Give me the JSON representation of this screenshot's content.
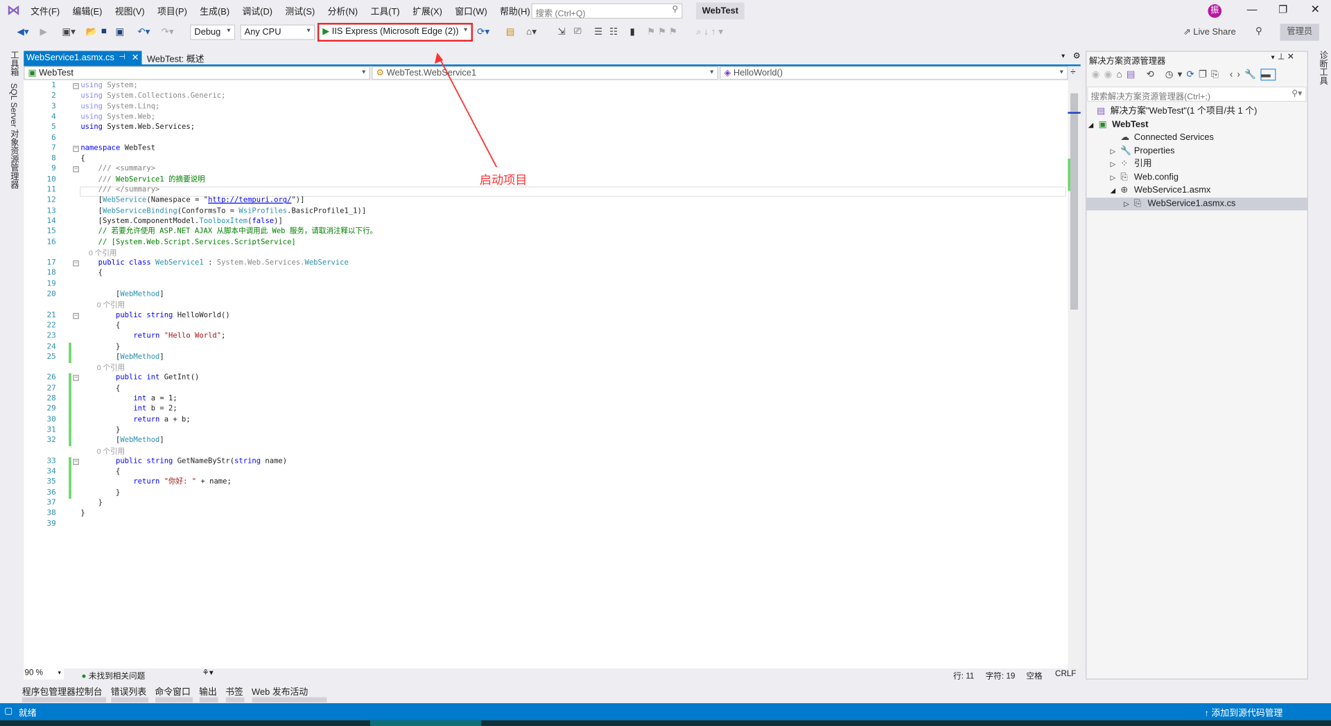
{
  "menu": [
    "文件(F)",
    "编辑(E)",
    "视图(V)",
    "项目(P)",
    "生成(B)",
    "调试(D)",
    "测试(S)",
    "分析(N)",
    "工具(T)",
    "扩展(X)",
    "窗口(W)",
    "帮助(H)"
  ],
  "search_placeholder": "搜索 (Ctrl+Q)",
  "solution_badge": "WebTest",
  "avatar_letter": "振",
  "toolbar": {
    "config": "Debug",
    "platform": "Any CPU",
    "start": "IIS Express (Microsoft Edge (2))",
    "live_share": "Live Share",
    "admin": "管理员"
  },
  "left_strip": [
    "工具箱",
    "SQL Server 对象资源管理器"
  ],
  "right_strip": "诊断工具",
  "tabs": [
    {
      "label": "WebService1.asmx.cs",
      "active": true
    },
    {
      "label": "WebTest: 概述",
      "active": false
    }
  ],
  "nav": {
    "project": "WebTest",
    "class": "WebTest.WebService1",
    "member": "HelloWorld()"
  },
  "annotation": {
    "label": "启动项目",
    "color": "#ff3333"
  },
  "code": [
    {
      "n": "1",
      "t": [
        [
          "fd",
          "using"
        ],
        [
          "fg",
          " System;"
        ]
      ]
    },
    {
      "n": "2",
      "t": [
        [
          "fd",
          "using"
        ],
        [
          "fg",
          " System.Collections.Generic;"
        ]
      ]
    },
    {
      "n": "3",
      "t": [
        [
          "fd",
          "using"
        ],
        [
          "fg",
          " System.Linq;"
        ]
      ]
    },
    {
      "n": "4",
      "t": [
        [
          "fd",
          "using"
        ],
        [
          "fg",
          " System.Web;"
        ]
      ]
    },
    {
      "n": "5",
      "t": [
        [
          "kw",
          "using"
        ],
        [
          "tx",
          " System.Web.Services;"
        ]
      ]
    },
    {
      "n": "6",
      "t": []
    },
    {
      "n": "7",
      "t": [
        [
          "kw",
          "namespace"
        ],
        [
          "tx",
          " WebTest"
        ]
      ]
    },
    {
      "n": "8",
      "t": [
        [
          "tx",
          "{"
        ]
      ]
    },
    {
      "n": "9",
      "t": [
        [
          "dc",
          "    /// <summary>"
        ]
      ]
    },
    {
      "n": "10",
      "t": [
        [
          "dc",
          "    /// "
        ],
        [
          "cm",
          "WebService1 的摘要说明"
        ]
      ]
    },
    {
      "n": "11",
      "t": [
        [
          "dc",
          "    /// </summary>"
        ]
      ]
    },
    {
      "n": "12",
      "t": [
        [
          "tx",
          "    ["
        ],
        [
          "ty",
          "WebService"
        ],
        [
          "tx",
          "(Namespace = \""
        ],
        [
          "url",
          "http://tempuri.org/"
        ],
        [
          "tx",
          "\")]"
        ]
      ]
    },
    {
      "n": "13",
      "t": [
        [
          "tx",
          "    ["
        ],
        [
          "ty",
          "WebServiceBinding"
        ],
        [
          "tx",
          "(ConformsTo = "
        ],
        [
          "ty",
          "WsiProfiles"
        ],
        [
          "tx",
          ".BasicProfile1_1)]"
        ]
      ]
    },
    {
      "n": "14",
      "t": [
        [
          "tx",
          "    [System.ComponentModel."
        ],
        [
          "ty",
          "ToolboxItem"
        ],
        [
          "tx",
          "("
        ],
        [
          "kw",
          "false"
        ],
        [
          "tx",
          ")]"
        ]
      ]
    },
    {
      "n": "15",
      "t": [
        [
          "cm",
          "    // 若要允许使用 ASP.NET AJAX 从脚本中调用此 Web 服务，请取消注释以下行。"
        ]
      ]
    },
    {
      "n": "16",
      "t": [
        [
          "cm",
          "    // [System.Web.Script.Services.ScriptService]"
        ]
      ]
    },
    {
      "n": "",
      "t": [
        [
          "lens",
          "    0 个引用"
        ]
      ]
    },
    {
      "n": "17",
      "t": [
        [
          "kw",
          "    public class "
        ],
        [
          "ty",
          "WebService1"
        ],
        [
          "tx",
          " : "
        ],
        [
          "fg",
          "System.Web.Services."
        ],
        [
          "ty",
          "WebService"
        ]
      ]
    },
    {
      "n": "18",
      "t": [
        [
          "tx",
          "    {"
        ]
      ]
    },
    {
      "n": "19",
      "t": []
    },
    {
      "n": "20",
      "t": [
        [
          "tx",
          "        ["
        ],
        [
          "ty",
          "WebMethod"
        ],
        [
          "tx",
          "]"
        ]
      ]
    },
    {
      "n": "",
      "t": [
        [
          "lens",
          "        0 个引用"
        ]
      ]
    },
    {
      "n": "21",
      "t": [
        [
          "kw",
          "        public string "
        ],
        [
          "tx",
          "HelloWorld()"
        ]
      ]
    },
    {
      "n": "22",
      "t": [
        [
          "tx",
          "        {"
        ]
      ]
    },
    {
      "n": "23",
      "t": [
        [
          "kw",
          "            return "
        ],
        [
          "st",
          "\"Hello World\""
        ],
        [
          "tx",
          ";"
        ]
      ]
    },
    {
      "n": "24",
      "t": [
        [
          "tx",
          "        }"
        ]
      ]
    },
    {
      "n": "25",
      "t": [
        [
          "tx",
          "        ["
        ],
        [
          "ty",
          "WebMethod"
        ],
        [
          "tx",
          "]"
        ]
      ]
    },
    {
      "n": "",
      "t": [
        [
          "lens",
          "        0 个引用"
        ]
      ]
    },
    {
      "n": "26",
      "t": [
        [
          "kw",
          "        public int "
        ],
        [
          "tx",
          "GetInt()"
        ]
      ]
    },
    {
      "n": "27",
      "t": [
        [
          "tx",
          "        {"
        ]
      ]
    },
    {
      "n": "28",
      "t": [
        [
          "kw",
          "            int "
        ],
        [
          "tx",
          "a = 1;"
        ]
      ]
    },
    {
      "n": "29",
      "t": [
        [
          "kw",
          "            int "
        ],
        [
          "tx",
          "b = 2;"
        ]
      ]
    },
    {
      "n": "30",
      "t": [
        [
          "kw",
          "            return "
        ],
        [
          "tx",
          "a + b;"
        ]
      ]
    },
    {
      "n": "31",
      "t": [
        [
          "tx",
          "        }"
        ]
      ]
    },
    {
      "n": "32",
      "t": [
        [
          "tx",
          "        ["
        ],
        [
          "ty",
          "WebMethod"
        ],
        [
          "tx",
          "]"
        ]
      ]
    },
    {
      "n": "",
      "t": [
        [
          "lens",
          "        0 个引用"
        ]
      ]
    },
    {
      "n": "33",
      "t": [
        [
          "kw",
          "        public string "
        ],
        [
          "tx",
          "GetNameByStr("
        ],
        [
          "kw",
          "string "
        ],
        [
          "tx",
          "name)"
        ]
      ]
    },
    {
      "n": "34",
      "t": [
        [
          "tx",
          "        {"
        ]
      ]
    },
    {
      "n": "35",
      "t": [
        [
          "kw",
          "            return "
        ],
        [
          "st",
          "\"你好: \""
        ],
        [
          "tx",
          " + name;"
        ]
      ]
    },
    {
      "n": "36",
      "t": [
        [
          "tx",
          "        }"
        ]
      ]
    },
    {
      "n": "37",
      "t": [
        [
          "tx",
          "    }"
        ]
      ]
    },
    {
      "n": "38",
      "t": [
        [
          "tx",
          "}"
        ]
      ]
    },
    {
      "n": "39",
      "t": []
    }
  ],
  "editor_status": {
    "zoom": "90 %",
    "issues": "未找到相关问题",
    "line": "行: 11",
    "char": "字符: 19",
    "spaces": "空格",
    "eol": "CRLF"
  },
  "tool_tabs": [
    "程序包管理器控制台",
    "错误列表",
    "命令窗口",
    "输出",
    "书签",
    "Web 发布活动"
  ],
  "solution_explorer": {
    "title": "解决方案资源管理器",
    "search_placeholder": "搜索解决方案资源管理器(Ctrl+;)",
    "items": [
      {
        "label": "解决方案\"WebTest\"(1 个项目/共 1 个)",
        "expander": ""
      },
      {
        "label": "WebTest",
        "expander": "◢",
        "bold": true
      },
      {
        "label": "Connected Services",
        "expander": ""
      },
      {
        "label": "Properties",
        "expander": "▷"
      },
      {
        "label": "引用",
        "expander": "▷"
      },
      {
        "label": "Web.config",
        "expander": "▷"
      },
      {
        "label": "WebService1.asmx",
        "expander": "◢"
      },
      {
        "label": "WebService1.asmx.cs",
        "expander": "▷",
        "selected": true
      }
    ]
  },
  "statusbar": {
    "left": "就绪",
    "right": "添加到源代码管理"
  }
}
